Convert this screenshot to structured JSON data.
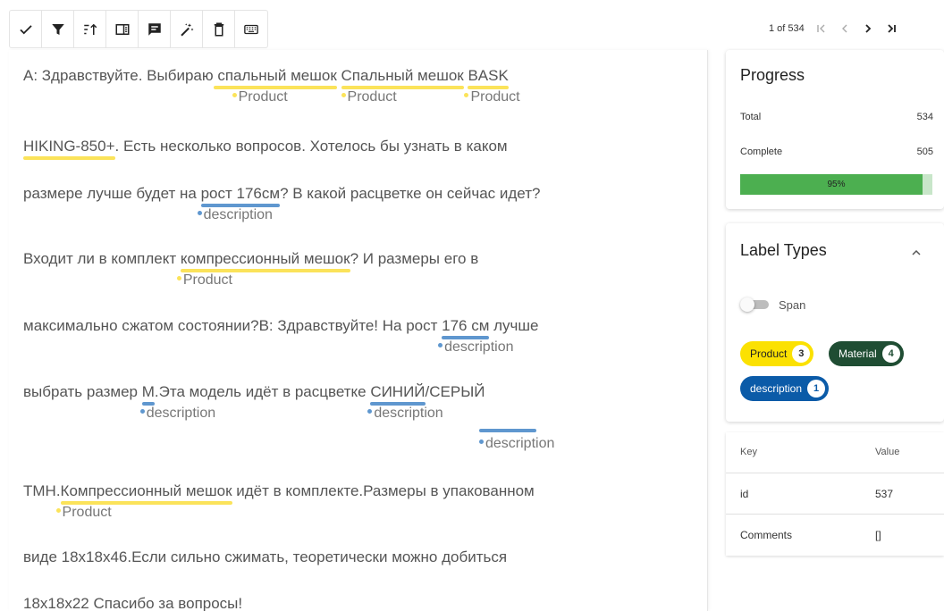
{
  "toolbar": {
    "buttons": [
      {
        "name": "check-icon"
      },
      {
        "name": "filter-icon"
      },
      {
        "name": "sort-icon"
      },
      {
        "name": "layout-icon"
      },
      {
        "name": "comment-icon"
      },
      {
        "name": "magic-wand-icon"
      },
      {
        "name": "trash-icon"
      },
      {
        "name": "keyboard-icon"
      }
    ]
  },
  "pager": {
    "text": "1 of 534"
  },
  "document": {
    "lines": [
      {
        "segs": [
          "A: Здравствуйте. Выбираю",
          " спальный мешок",
          " ",
          "Спальный мешок",
          " ",
          "BASK"
        ]
      },
      {
        "segs": [
          "HIKING-850+",
          ". Есть несколько вопросов. Хотелось бы узнать в каком"
        ]
      },
      {
        "segs": [
          "размере лучше будет на ",
          "рост 176см",
          "? В какой расцветке он сейчас идет?"
        ]
      },
      {
        "segs": [
          "Входит ли в комплект ",
          "компрессионный мешок",
          "? И размеры его в"
        ]
      },
      {
        "segs": [
          "максимально сжатом состоянии?В: Здравствуйте! На рост ",
          "176 см",
          " лучше"
        ]
      },
      {
        "segs": [
          "выбрать размер ",
          "М",
          ".Эта модель идёт в расцветке ",
          "СИНИЙ",
          "/СЕРЫЙ"
        ]
      },
      {
        "segs": [
          "ТМН.",
          "Компрессионный мешок",
          " идёт в комплекте.Размеры в упакованном"
        ]
      },
      {
        "segs": [
          "виде 18х18х46.Если сильно сжимать, теоретически можно добиться"
        ]
      },
      {
        "segs": [
          "18х18х22 Спасибо за вопросы!"
        ]
      }
    ],
    "tags": {
      "product": "Product",
      "description": "description"
    }
  },
  "progress": {
    "title": "Progress",
    "total_label": "Total",
    "total_value": "534",
    "complete_label": "Complete",
    "complete_value": "505",
    "percent_label": "95%",
    "fraction": 0.95,
    "fill_color": "#4caf50",
    "track_color": "#c8e6c9"
  },
  "label_types": {
    "title": "Label Types",
    "switch_label": "Span",
    "chips": [
      {
        "label": "Product",
        "count": "3",
        "color": "#fbe102"
      },
      {
        "label": "Material",
        "count": "4",
        "color": "#1f4d33"
      },
      {
        "label": "description",
        "count": "1",
        "color": "#0b5ba8"
      }
    ]
  },
  "metadata": {
    "key_header": "Key",
    "value_header": "Value",
    "rows": [
      {
        "key": "id",
        "value": "537"
      },
      {
        "key": "Comments",
        "value": "[]"
      }
    ]
  }
}
